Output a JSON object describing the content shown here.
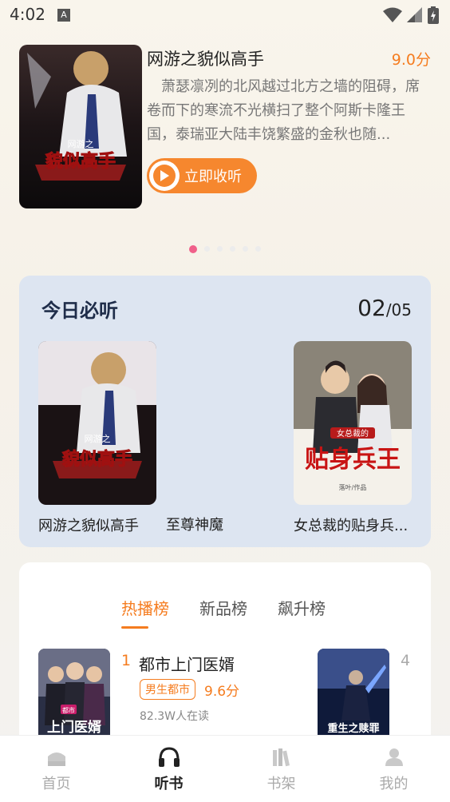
{
  "status_bar": {
    "time": "4:02",
    "notification_letter": "A"
  },
  "hero": {
    "title": "网游之貌似高手",
    "score": "9.0分",
    "description": "萧瑟凛冽的北风越过北方之墙的阻碍，席卷而下的寒流不光横扫了整个阿斯卡隆王国，泰瑞亚大陆丰饶繁盛的金秋也随...",
    "listen_label": "立即收听",
    "cover_text": {
      "small": "网游之",
      "big": "貌似高手"
    },
    "carousel": {
      "count": 6,
      "active_index": 0
    }
  },
  "today": {
    "title": "今日必听",
    "page_current": "02",
    "page_total": "/05",
    "books": [
      {
        "name": "网游之貌似高手",
        "cover_small": "网游之",
        "cover_big": "貌似高手"
      },
      {
        "name": "至尊神魔"
      },
      {
        "name": "女总裁的贴身兵...",
        "cover_small": "女总裁的",
        "cover_big": "贴身兵王",
        "cover_author": "落叶/作品"
      }
    ]
  },
  "rank": {
    "tabs": [
      "热播榜",
      "新品榜",
      "飙升榜"
    ],
    "active_tab": 0,
    "items": [
      {
        "rank": "1",
        "name": "都市上门医婿",
        "tag": "男生都市",
        "score": "9.6分",
        "readers": "82.3W人在读",
        "cover_small": "都市",
        "cover_big": "上门医婿"
      },
      {
        "rank": "4",
        "cover_big": "重生之赎罪"
      }
    ]
  },
  "nav": {
    "items": [
      {
        "label": "首页",
        "icon": "home-icon"
      },
      {
        "label": "听书",
        "icon": "headphones-icon"
      },
      {
        "label": "书架",
        "icon": "bookshelf-icon"
      },
      {
        "label": "我的",
        "icon": "profile-icon"
      }
    ],
    "active_index": 1
  },
  "colors": {
    "accent": "#f57c1f",
    "dot_active": "#f0608a",
    "card_bg": "#dde5f1"
  }
}
